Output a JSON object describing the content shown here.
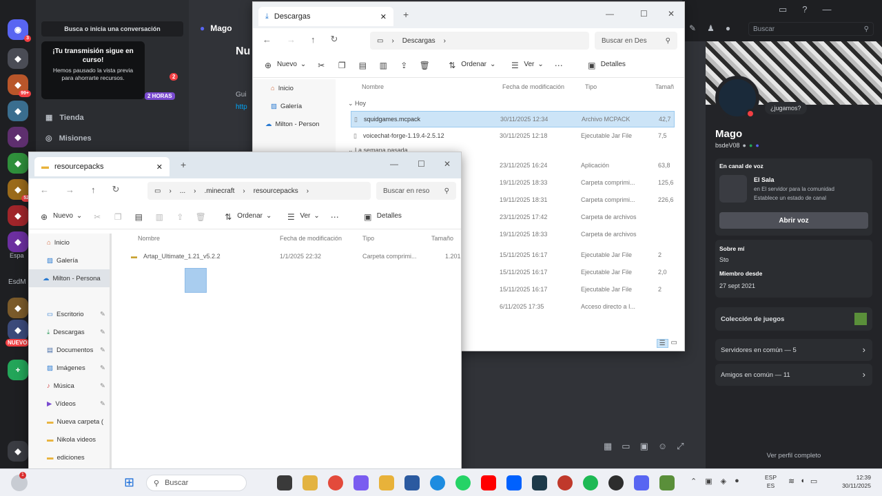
{
  "discord": {
    "search_conv": "Busca o inicia una conversación",
    "tooltip_title": "¡Tu transmisión sigue en curso!",
    "tooltip_body": "Hemos pausado la vista previa para ahorrarte recursos.",
    "badge_count": "2",
    "badge_hours": "2 HORAS",
    "store": "Tienda",
    "missions": "Misiones",
    "channel_name": "Mago",
    "chat_heading": "Nu",
    "chat_line": "Gui",
    "chat_link": "http",
    "server_labels": [
      "Espa",
      "EsdM"
    ],
    "server_new": "NUEVO",
    "rail_badges": [
      "3",
      "99+",
      "52"
    ],
    "top_search": "Buscar",
    "profile": {
      "speech": "¿jugamos?",
      "name": "Mago",
      "handle": "bsdeV08",
      "voice_heading": "En canal de voz",
      "voice_channel": "El Sala",
      "voice_server": "en El servidor para la comunidad",
      "voice_status": "Establece un estado de canal",
      "join_btn": "Abrir voz",
      "about_label": "Sobre mí",
      "about_text": "Sto",
      "member_label": "Miembro desde",
      "member_date": "27 sept 2021",
      "collection": "Colección de juegos",
      "servers_common": "Servidores en común — 5",
      "friends_common": "Amigos en común — 11",
      "full_profile": "Ver perfil completo"
    }
  },
  "explorer_back": {
    "tab": "Descargas",
    "crumb": "Descargas",
    "search": "Buscar en Des",
    "new": "Nuevo",
    "sort": "Ordenar",
    "view": "Ver",
    "details": "Detalles",
    "nav": [
      "Inicio",
      "Galería",
      "Milton - Person"
    ],
    "headers": [
      "Nombre",
      "Fecha de modificación",
      "Tipo",
      "Tamañ"
    ],
    "group_today": "Hoy",
    "group_week": "La semana pasada",
    "rows": [
      {
        "name": "squidgames.mcpack",
        "date": "30/11/2025 12:34",
        "type": "Archivo MCPACK",
        "size": "42,7"
      },
      {
        "name": "voicechat-forge-1.19.4-2.5.12",
        "date": "30/11/2025 12:18",
        "type": "Ejecutable Jar File",
        "size": "7,5"
      },
      {
        "name": "",
        "date": "23/11/2025 16:24",
        "type": "Aplicación",
        "size": "63,8"
      },
      {
        "name": "",
        "date": "19/11/2025 18:33",
        "type": "Carpeta comprimi...",
        "size": "125,6"
      },
      {
        "name": "",
        "date": "19/11/2025 18:31",
        "type": "Carpeta comprimi...",
        "size": "226,6"
      },
      {
        "name": "",
        "date": "23/11/2025 17:42",
        "type": "Carpeta de archivos",
        "size": ""
      },
      {
        "name": "",
        "date": "19/11/2025 18:33",
        "type": "Carpeta de archivos",
        "size": ""
      },
      {
        "name": "",
        "date": "15/11/2025 16:17",
        "type": "Ejecutable Jar File",
        "size": "2"
      },
      {
        "name": "",
        "date": "15/11/2025 16:17",
        "type": "Ejecutable Jar File",
        "size": "2,0"
      },
      {
        "name": "",
        "date": "15/11/2025 16:17",
        "type": "Ejecutable Jar File",
        "size": "2"
      },
      {
        "name": "",
        "date": "6/11/2025 17:35",
        "type": "Acceso directo a I...",
        "size": ""
      }
    ]
  },
  "explorer_front": {
    "tab": "resourcepacks",
    "crumb_ellipsis": "...",
    "crumb1": ".minecraft",
    "crumb2": "resourcepacks",
    "search": "Buscar en reso",
    "new": "Nuevo",
    "sort": "Ordenar",
    "view": "Ver",
    "details": "Detalles",
    "nav": [
      "Inicio",
      "Galería",
      "Milton - Persona",
      "Escritorio",
      "Descargas",
      "Documentos",
      "Imágenes",
      "Música",
      "Vídeos",
      "Nueva carpeta (",
      "Nikola videos",
      "ediciones"
    ],
    "headers": [
      "Nombre",
      "Fecha de modificación",
      "Tipo",
      "Tamaño"
    ],
    "rows": [
      {
        "name": "Artap_Ultimate_1.21_v5.2.2",
        "date": "1/1/2025 22:32",
        "type": "Carpeta comprimi...",
        "size": "1.201"
      }
    ]
  },
  "taskbar": {
    "search": "Buscar",
    "lang1": "ESP",
    "lang2": "ES",
    "time": "12:39",
    "date": "30/11/2025",
    "notif": "1"
  }
}
